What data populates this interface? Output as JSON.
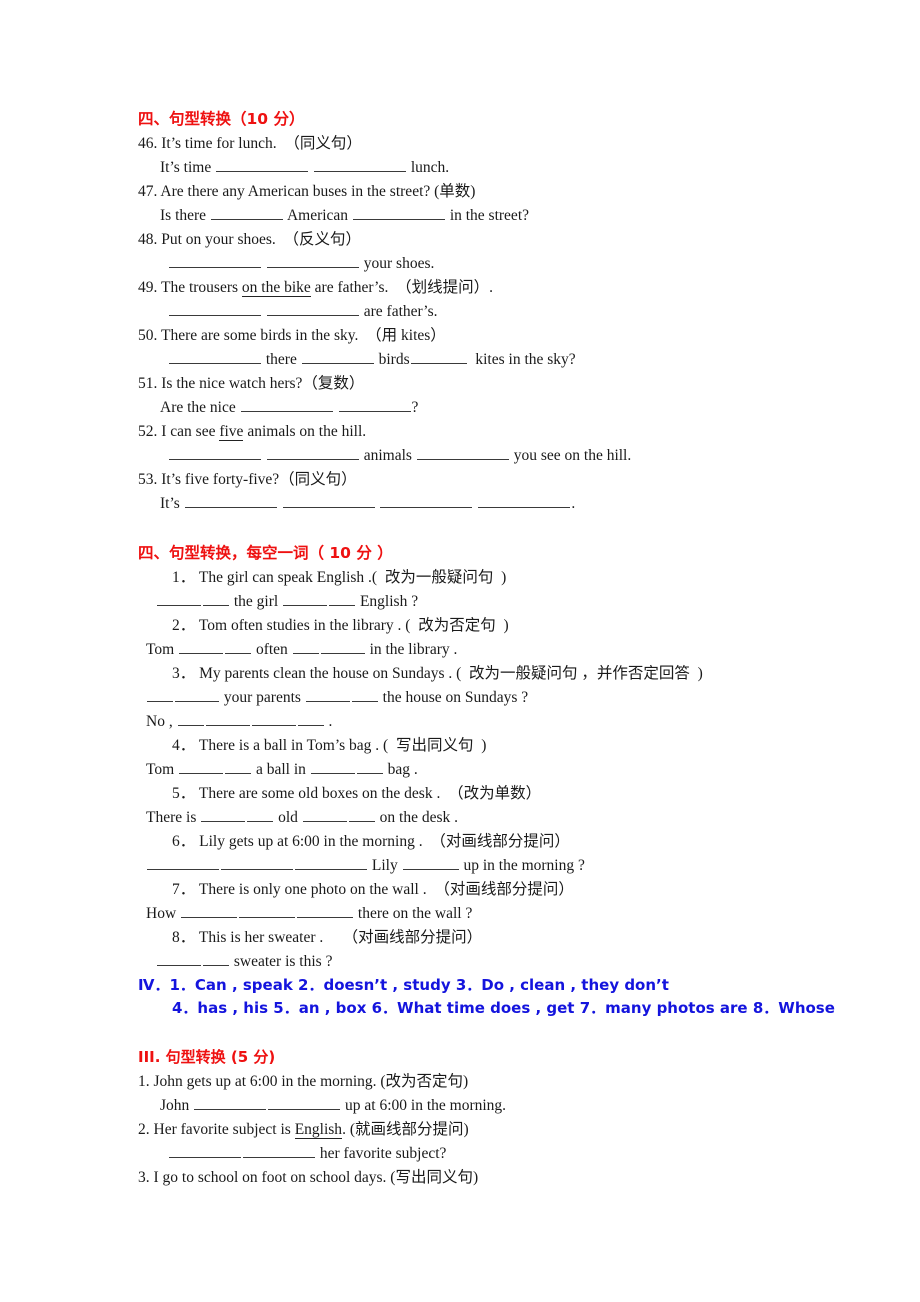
{
  "document": {
    "type": "english-grammar-worksheet",
    "colors": {
      "heading_red": "#ee1111",
      "answer_blue": "#1414dd",
      "body_text": "#1a1a1a",
      "background": "#ffffff"
    }
  },
  "section1": {
    "heading": "四、句型转换（10 分）",
    "items": [
      {
        "number": "46.",
        "prompt": "It’s time for lunch.  （同义句）",
        "answer_parts": [
          "It’s time ",
          " ",
          " lunch."
        ]
      },
      {
        "number": "47.",
        "prompt": "Are there any American buses in the street? (单数)",
        "answer_parts": [
          "Is there ",
          " American ",
          " in the street?"
        ]
      },
      {
        "number": "48.",
        "prompt": "Put on your shoes.  （反义句）",
        "answer_parts": [
          "",
          " ",
          " your shoes."
        ]
      },
      {
        "number": "49.",
        "prompt_pre": "The trousers ",
        "prompt_underlined": "on the bike",
        "prompt_post": " are father’s.  （划线提问）.",
        "answer_parts": [
          "",
          " ",
          " are father’s."
        ]
      },
      {
        "number": "50.",
        "prompt": "There are some birds in the sky.  （用 kites）",
        "answer_parts": [
          "",
          " there ",
          " birds",
          "  kites in the sky?"
        ]
      },
      {
        "number": "51.",
        "prompt": "Is the nice watch hers?（复数）",
        "answer_parts": [
          "Are the nice ",
          " ",
          "?"
        ]
      },
      {
        "number": "52.",
        "prompt_pre": "I can see ",
        "prompt_underlined": "five",
        "prompt_post": " animals on the hill.",
        "answer_parts": [
          "",
          " ",
          " animals ",
          " you see on the hill."
        ]
      },
      {
        "number": "53.",
        "prompt": "It’s five forty-five?（同义句）",
        "answer_parts": [
          "It’s ",
          " ",
          " ",
          " ",
          "."
        ]
      }
    ]
  },
  "section2": {
    "heading": "四、句型转换，每空一词（ 10 分 ）",
    "items": [
      {
        "number": "1．",
        "prompt": "The girl can speak English .(  改为一般疑问句  )",
        "answer_parts": [
          "",
          " ",
          " the girl ",
          " ",
          " English ?"
        ]
      },
      {
        "number": "2．",
        "prompt": "Tom often studies in the library . (  改为否定句  )",
        "answer_parts": [
          "Tom ",
          " ",
          " often ",
          " ",
          " in the library ."
        ]
      },
      {
        "number": "3．",
        "prompt": "My parents clean the house on Sundays . (  改为一般疑问句 ，并作否定回答  )",
        "answer_parts": [
          "",
          " ",
          " your parents ",
          " ",
          " the house on Sundays ?"
        ],
        "answer_parts_2": [
          "No , ",
          " ",
          " ",
          " ",
          " ."
        ]
      },
      {
        "number": "4．",
        "prompt": "There is a ball in Tom’s bag . (  写出同义句  )",
        "answer_parts": [
          "Tom ",
          " ",
          " a ball in ",
          " ",
          " bag ."
        ]
      },
      {
        "number": "5．",
        "prompt": "There are some old boxes on the desk .  （改为单数）",
        "answer_parts": [
          "There is ",
          " ",
          " old ",
          " ",
          " on the desk ."
        ]
      },
      {
        "number": "6．",
        "prompt": "Lily gets up at 6:00 in the morning .  （对画线部分提问）",
        "answer_parts": [
          "",
          " ",
          " ",
          " Lily ",
          " up in the morning ?"
        ]
      },
      {
        "number": "7．",
        "prompt": "There is only one photo on the wall .  （对画线部分提问）",
        "answer_parts": [
          "How ",
          " ",
          " ",
          " there on the wall ?"
        ]
      },
      {
        "number": "8．",
        "prompt": "This is her sweater .     （对画线部分提问）",
        "answer_parts": [
          "",
          " ",
          " sweater is this ?"
        ]
      }
    ],
    "answer_key": {
      "line1": "Ⅳ．1．Can , speak 2．doesn’t , study 3．Do , clean , they don’t",
      "line2": "4．has , his 5．an , box 6．What time does , get 7．many photos are 8．Whose"
    }
  },
  "section3": {
    "heading": "III. 句型转换 (5 分)",
    "items": [
      {
        "number": "1.",
        "prompt": "John gets up at 6:00 in the morning. (改为否定句)",
        "answer_parts": [
          "John ",
          " ",
          " up at 6:00 in the morning."
        ]
      },
      {
        "number": "2.",
        "prompt_pre": "Her favorite subject is ",
        "prompt_underlined": "English",
        "prompt_post": ". (就画线部分提问)",
        "answer_parts": [
          "",
          " ",
          " her favorite subject?"
        ]
      },
      {
        "number": "3.",
        "prompt": "I go to school on foot on school days. (写出同义句)"
      }
    ]
  }
}
